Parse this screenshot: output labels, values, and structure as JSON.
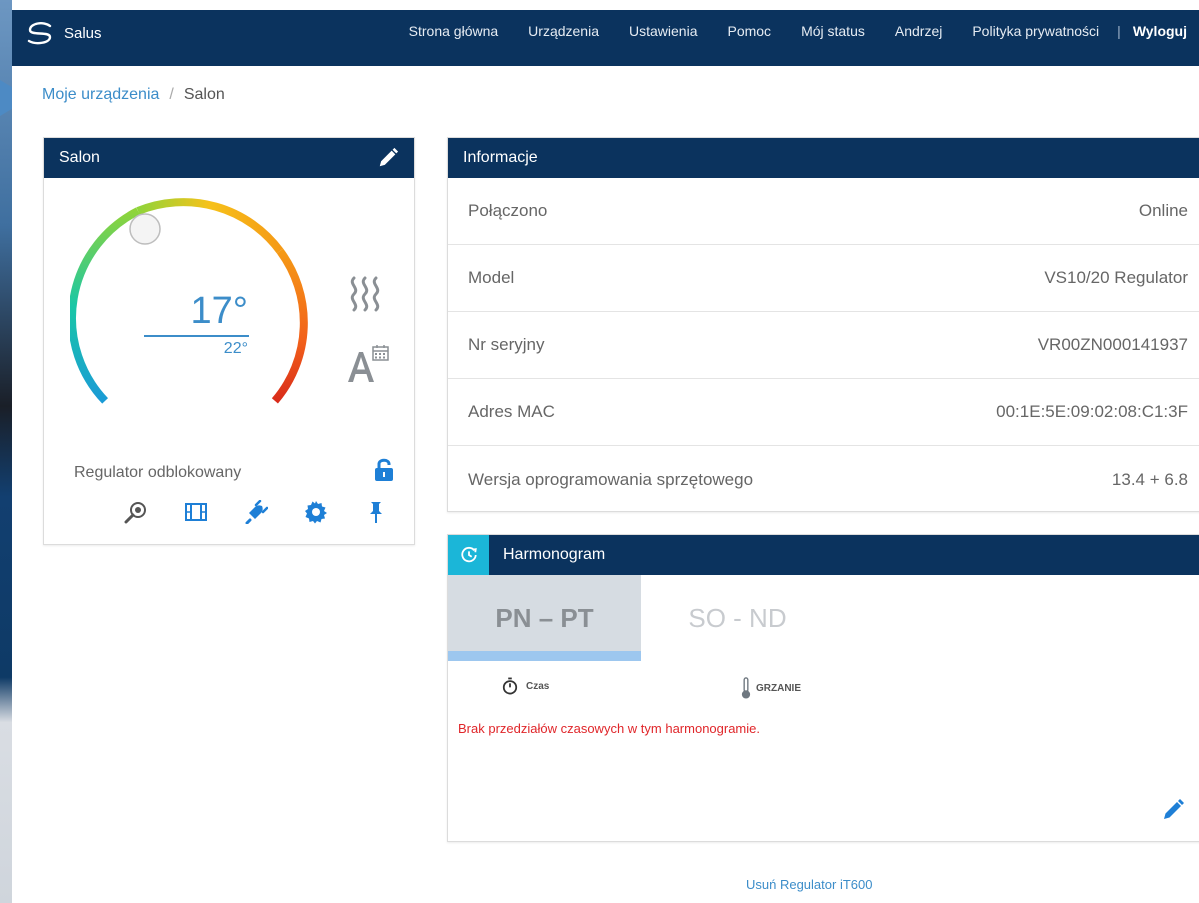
{
  "app": {
    "logo_text": "Salus"
  },
  "nav": {
    "items": [
      "Strona główna",
      "Urządzenia",
      "Ustawienia",
      "Pomoc",
      "Mój status",
      "Andrzej",
      "Polityka prywatności"
    ],
    "separator": "|",
    "logout": "Wyloguj"
  },
  "breadcrumb": {
    "parent": "Moje urządzenia",
    "separator": "/",
    "current": "Salon"
  },
  "device": {
    "title": "Salon",
    "current_temp": "17°",
    "set_temp": "22°",
    "lock_status": "Regulator odblokowany"
  },
  "info": {
    "title": "Informacje",
    "rows": [
      {
        "label": "Połączono",
        "value": "Online"
      },
      {
        "label": "Model",
        "value": "VS10/20 Regulator"
      },
      {
        "label": "Nr seryjny",
        "value": "VR00ZN000141937"
      },
      {
        "label": "Adres MAC",
        "value": "00:1E:5E:09:02:08:C1:3F"
      },
      {
        "label": "Wersja oprogramowania sprzętowego",
        "value": "13.4 + 6.8"
      }
    ]
  },
  "schedule": {
    "title": "Harmonogram",
    "tabs": [
      "PN – PT",
      "SO - ND"
    ],
    "col_time": "Czas",
    "col_heating": "GRZANIE",
    "empty_message": "Brak przedziałów czasowych w tym harmonogramie."
  },
  "footer": {
    "remove_link": "Usuń Regulator iT600"
  },
  "colors": {
    "header": "#0b335e",
    "accent": "#3c8dc9",
    "cyan": "#1bb6d8",
    "error": "#e0262a"
  }
}
